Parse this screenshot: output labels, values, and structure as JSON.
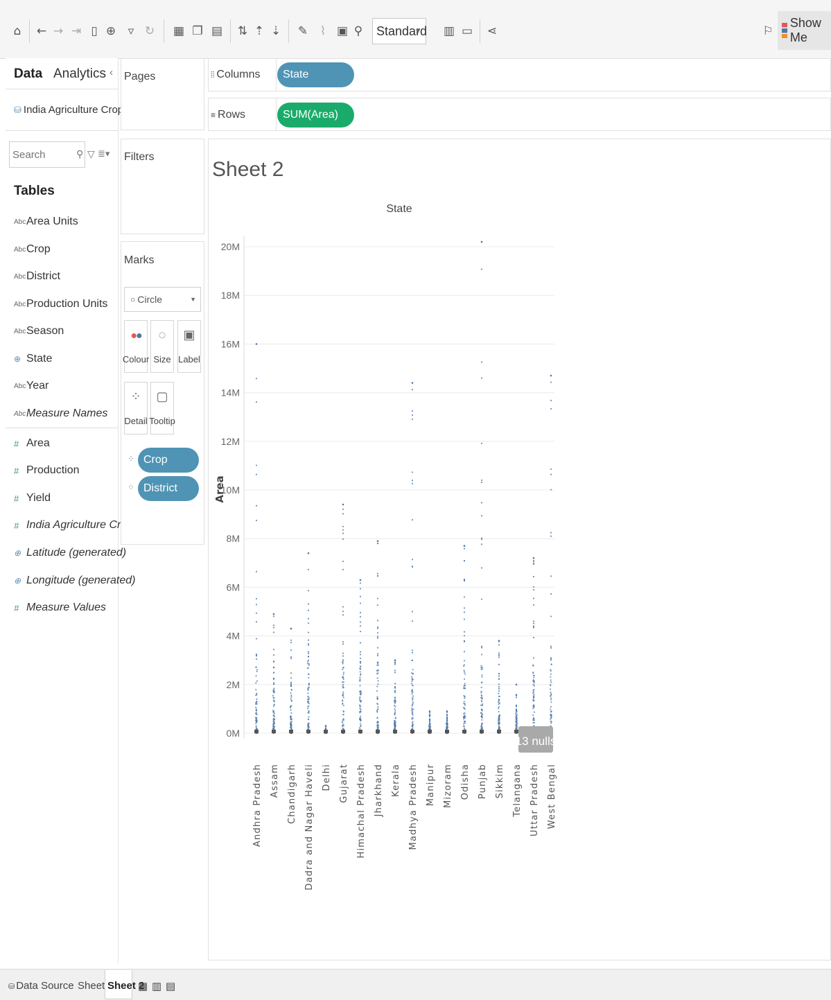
{
  "toolbar": {
    "fit_mode": "Standard",
    "show_me_label": "Show Me",
    "icons": [
      "home-icon",
      "undo-icon",
      "redo-icon",
      "save-icon",
      "new-datasource-icon",
      "new-worksheet-icon",
      "refresh-icon",
      "swap-icon",
      "sort-icon",
      "highlight-icon",
      "label-icon",
      "pin-icon",
      "fit-icon",
      "presentation-icon",
      "share-icon"
    ]
  },
  "data_pane": {
    "tab_data": "Data",
    "tab_analytics": "Analytics",
    "collapse_glyph": "‹",
    "datasource_name": "India Agriculture Crop Pro...",
    "search_placeholder": "Search",
    "tables_heading": "Tables",
    "fields": [
      {
        "type": "Abc",
        "label": "Area Units",
        "italic": false
      },
      {
        "type": "Abc",
        "label": "Crop",
        "italic": false
      },
      {
        "type": "Abc",
        "label": "District",
        "italic": false
      },
      {
        "type": "Abc",
        "label": "Production Units",
        "italic": false
      },
      {
        "type": "Abc",
        "label": "Season",
        "italic": false
      },
      {
        "type": "globe",
        "label": "State",
        "italic": false
      },
      {
        "type": "Abc",
        "label": "Year",
        "italic": false
      },
      {
        "type": "Abc",
        "label": "Measure Names",
        "italic": true
      },
      {
        "type": "#",
        "label": "Area",
        "italic": false
      },
      {
        "type": "#",
        "label": "Production",
        "italic": false
      },
      {
        "type": "#",
        "label": "Yield",
        "italic": false
      },
      {
        "type": "#",
        "label": "India Agriculture Crop Prod...",
        "italic": true
      },
      {
        "type": "globe",
        "label": "Latitude (generated)",
        "italic": true
      },
      {
        "type": "globe",
        "label": "Longitude (generated)",
        "italic": true
      },
      {
        "type": "#",
        "label": "Measure Values",
        "italic": true
      }
    ]
  },
  "cards": {
    "pages": "Pages",
    "filters": "Filters",
    "marks": "Marks",
    "mark_type": "Circle",
    "mark_buttons": [
      "Colour",
      "Size",
      "Label",
      "Detail",
      "Tooltip"
    ],
    "marks_pills": [
      "Crop",
      "District"
    ]
  },
  "shelves": {
    "columns_label": "Columns",
    "columns_pill": "State",
    "rows_label": "Rows",
    "rows_pill": "SUM(Area)"
  },
  "sheet": {
    "title": "Sheet 2",
    "nulls_badge": "13 nulls"
  },
  "bottom_tabs": {
    "data_source": "Data Source",
    "sheets": [
      "Sheet 1",
      "Sheet 2"
    ],
    "active": "Sheet 2"
  },
  "chart_data": {
    "type": "scatter",
    "title": "",
    "header": "State",
    "ylabel": "Area",
    "ylim": [
      0,
      20000000
    ],
    "yticks": [
      0,
      2000000,
      4000000,
      6000000,
      8000000,
      10000000,
      12000000,
      14000000,
      16000000,
      18000000,
      20000000
    ],
    "ytick_labels": [
      "0M",
      "2M",
      "4M",
      "6M",
      "8M",
      "10M",
      "12M",
      "14M",
      "16M",
      "18M",
      "20M"
    ],
    "categories": [
      "Andhra Pradesh",
      "Assam",
      "Chandigarh",
      "Dadra and Nagar Haveli",
      "Delhi",
      "Gujarat",
      "Himachal Pradesh",
      "Jharkhand",
      "Kerala",
      "Madhya Pradesh",
      "Manipur",
      "Mizoram",
      "Odisha",
      "Punjab",
      "Sikkim",
      "Telangana",
      "Uttar Pradesh",
      "West Bengal"
    ],
    "column_max": [
      [
        0,
        16000000
      ],
      [
        1,
        4900000
      ],
      [
        2,
        4300000
      ],
      [
        3,
        7400000
      ],
      [
        4,
        300000
      ],
      [
        5,
        9400000
      ],
      [
        6,
        6300000
      ],
      [
        7,
        7900000
      ],
      [
        8,
        3000000
      ],
      [
        9,
        14400000
      ],
      [
        10,
        900000
      ],
      [
        11,
        900000
      ],
      [
        12,
        7700000
      ],
      [
        13,
        20200000
      ],
      [
        14,
        3800000
      ],
      [
        15,
        2000000
      ],
      [
        16,
        7200000
      ],
      [
        17,
        14700000
      ]
    ],
    "series_color": "#4e79a7"
  }
}
